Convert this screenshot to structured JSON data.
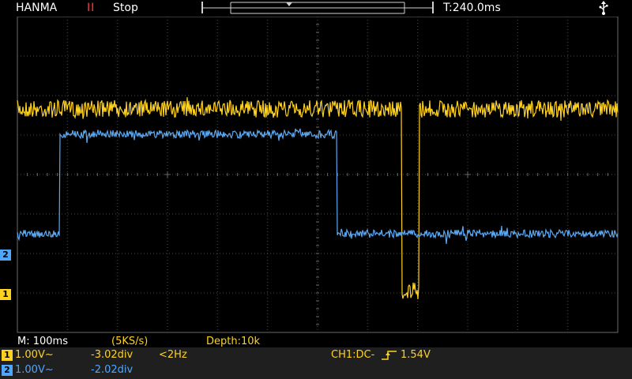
{
  "header": {
    "brand": "HANMA",
    "run_icon": "II",
    "run_state": "Stop",
    "timebase": "T:240.0ms",
    "usb_icon": "usb-icon"
  },
  "status": {
    "timebase_label": "M: 100ms",
    "sample_rate": "(5KS/s)",
    "depth": "Depth:10k"
  },
  "channels": [
    {
      "index": "1",
      "color": "#ffd21f",
      "scale": "1.00V~",
      "offset": "-3.02div",
      "frequency": "<2Hz"
    },
    {
      "index": "2",
      "color": "#4ea7ff",
      "scale": "1.00V~",
      "offset": "-2.02div"
    }
  ],
  "trigger": {
    "label": "CH1:DC-",
    "edge_icon": "rising-edge-icon",
    "level": "1.54V"
  },
  "markers": {
    "ch1": "1",
    "ch2": "2"
  }
}
